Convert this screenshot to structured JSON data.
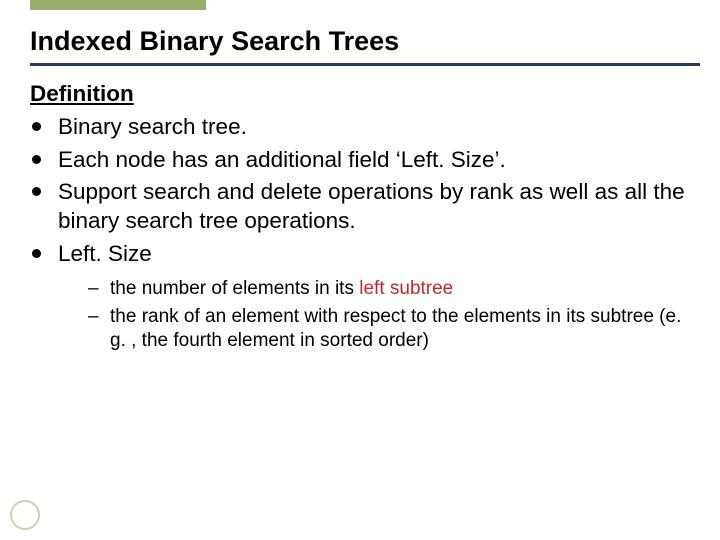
{
  "title": "Indexed Binary Search Trees",
  "section_heading": "Definition",
  "bullets": [
    "Binary search tree.",
    "Each node has an additional field ‘Left. Size’.",
    "Support search and delete operations by rank as well as all the binary search tree operations.",
    "Left. Size"
  ],
  "sub_bullets": {
    "prefix0": "the number of elements in its ",
    "highlight0": "left subtree",
    "line1": "the rank of an element with respect to the elements in its subtree (e. g. , the fourth element in sorted order)"
  },
  "colors": {
    "accent_green": "#9aad6a",
    "rule_navy": "#2a3a66",
    "highlight_red": "#c62828"
  }
}
